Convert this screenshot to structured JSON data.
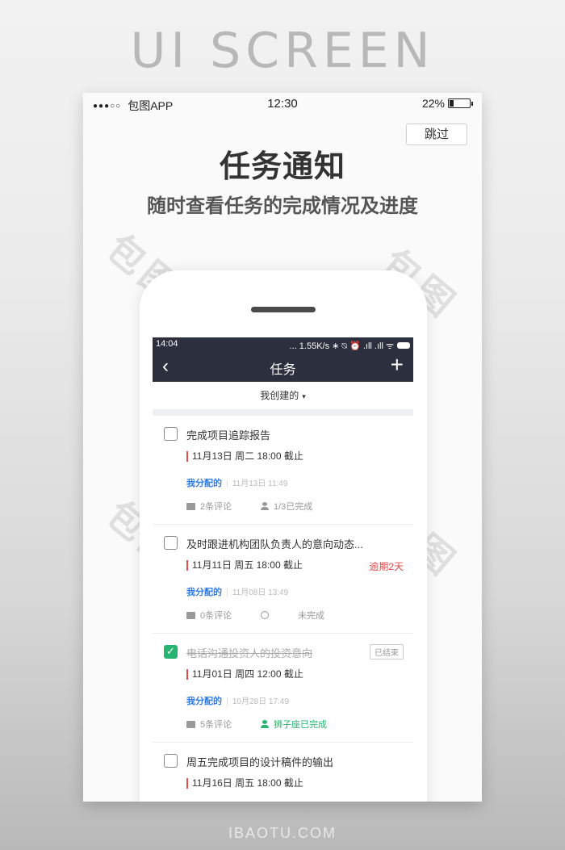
{
  "banner": {
    "title": "UI SCREEN",
    "footer": "IBAOTU.COM"
  },
  "ios_status": {
    "signal": "●●●○○",
    "carrier": "包图APP",
    "time": "12:30",
    "battery": "22%",
    "battery_level": 0.22
  },
  "skip_label": "跳过",
  "hero": {
    "title": "任务通知",
    "subtitle": "随时查看任务的完成情况及进度"
  },
  "watermark": "包图网",
  "app": {
    "status": {
      "time": "14:04",
      "right": "... 1.55K/s ∗ ⍉ ⏰ .ıll .ıll ᯤ"
    },
    "nav": {
      "back_icon": "‹",
      "title": "任务",
      "add_icon": "+"
    },
    "filter": {
      "label": "我创建的",
      "chevron": "⌄"
    },
    "tasks": [
      {
        "title": "完成项目追踪报告",
        "done": false,
        "deadline": "11月13日 周二 18:00 截止",
        "overdue": "",
        "assigner": "我分配的",
        "assigned_time": "11月13日 11:49",
        "comments": "2条评论",
        "status": "1/3已完成",
        "status_type": "person"
      },
      {
        "title": "及时跟进机构团队负责人的意向动态...",
        "done": false,
        "deadline": "11月11日 周五 18:00 截止",
        "overdue": "逾期2天",
        "assigner": "我分配的",
        "assigned_time": "11月08日 13:49",
        "comments": "0条评论",
        "status": "未完成",
        "status_type": "circle"
      },
      {
        "title": "电话沟通投资人的投资意向",
        "done": true,
        "badge": "已结束",
        "deadline": "11月01日 周四 12:00 截止",
        "overdue": "",
        "assigner": "我分配的",
        "assigned_time": "10月28日 17:49",
        "comments": "5条评论",
        "status": "狮子座已完成",
        "status_type": "person-green"
      },
      {
        "title": "周五完成项目的设计稿件的输出",
        "done": false,
        "deadline": "11月16日 周五 18:00 截止"
      }
    ]
  },
  "colors": {
    "header_bg": "#2c2f3d",
    "accent_blue": "#2f7be5",
    "danger_red": "#e94a4a",
    "success_green": "#27b473"
  }
}
